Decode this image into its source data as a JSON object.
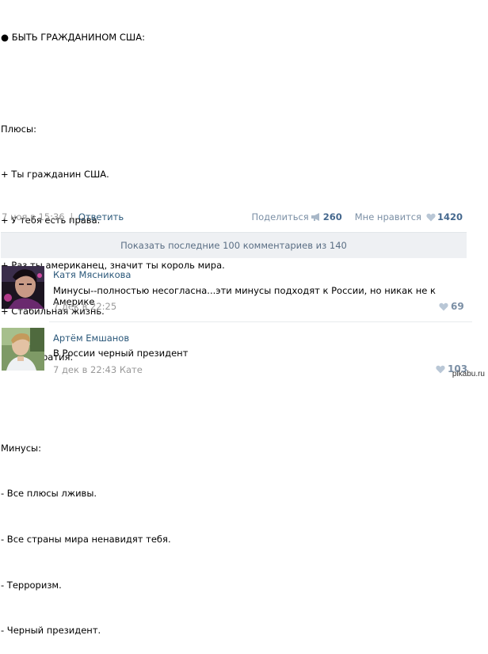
{
  "post": {
    "lines": [
      "● БЫТЬ ГРАЖДАНИНОМ США:",
      "",
      "Плюсы:",
      "+ Ты гражданин США.",
      "+ У тебя есть права.",
      "+ Раз ты американец, значит ты король мира.",
      "+ Стабильная жизнь.",
      "+ Демократия.",
      "",
      "Минусы:",
      "- Все плюсы лживы.",
      "- Все страны мира ненавидят тебя.",
      "- Терроризм.",
      "- Черный президент."
    ],
    "date": "7 ноя в 15:36",
    "separator": "|",
    "reply_label": "Ответить",
    "share_label": "Поделиться",
    "share_count": "260",
    "like_label": "Мне нравится",
    "like_count": "1420"
  },
  "show_more_label": "Показать последние 100 комментариев из 140",
  "comments": [
    {
      "author": "Катя Мясникова",
      "text": "Минусы--полностью несогласна...эти минусы подходят к России, но никак не к Америке",
      "date": "7 дек в 22:25",
      "reply_to": "",
      "likes": "69"
    },
    {
      "author": "Артём Емшанов",
      "text": "В России черный президент",
      "date": "7 дек в 22:43",
      "reply_to": "Кате",
      "likes": "103"
    }
  ],
  "watermark": "pikabu.ru",
  "colors": {
    "link": "#2b587a",
    "muted": "#999999",
    "meta": "#7b8fa5",
    "count": "#45688e",
    "bar": "#eef0f3"
  }
}
